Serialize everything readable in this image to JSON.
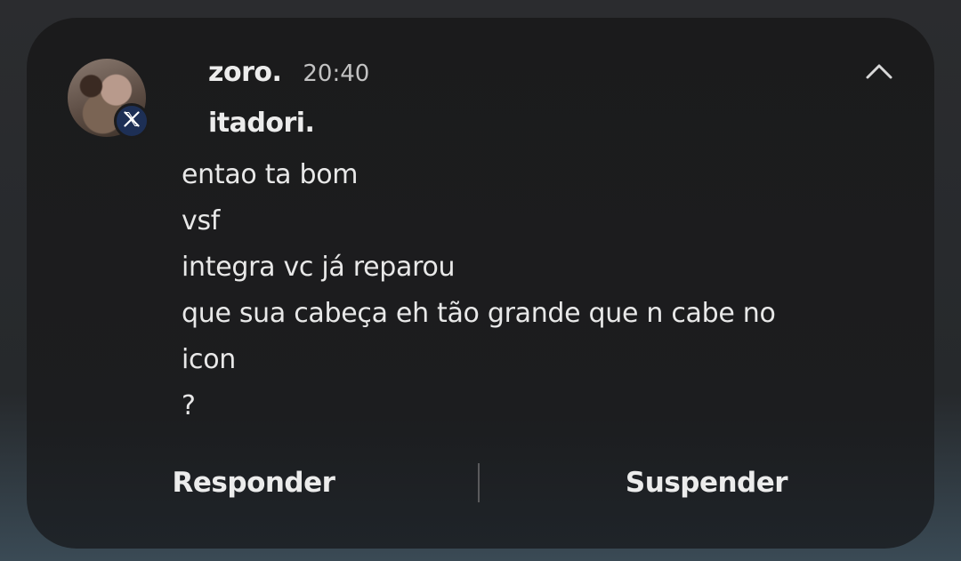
{
  "notification": {
    "sender": "zoro.",
    "time": "20:40",
    "conversation": "itadori.",
    "app_badge_icon": "x-logo-icon",
    "messages": [
      "entao ta bom",
      "vsf",
      "integra vc já reparou",
      "que sua cabeça eh tão grande que n cabe no",
      "icon",
      "?"
    ],
    "actions": {
      "reply_label": "Responder",
      "snooze_label": "Suspender"
    }
  },
  "colors": {
    "card_background": "#1b1b1c",
    "badge_background": "#1d2f55",
    "text_primary": "#ececec",
    "text_secondary": "#c2c2c2"
  }
}
